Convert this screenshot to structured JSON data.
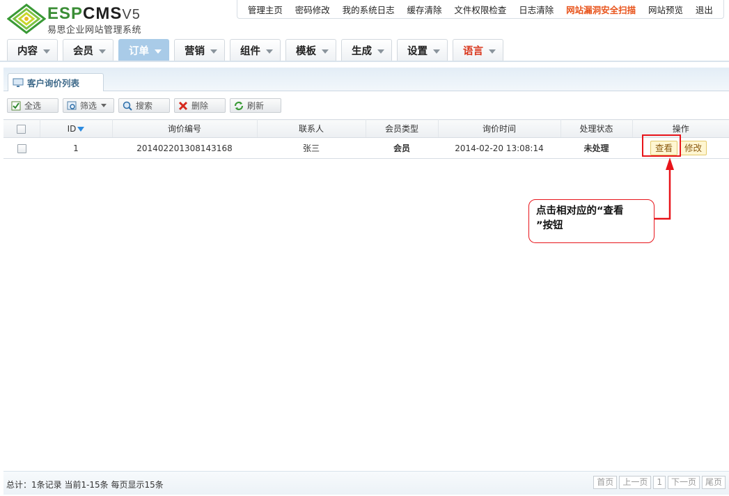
{
  "header": {
    "logo": {
      "brand_esp": "ESP",
      "brand_cms": "CMS",
      "brand_ver": "V5",
      "subtitle": "易思企业网站管理系统"
    },
    "top_links": [
      {
        "label": "管理主页"
      },
      {
        "label": "密码修改"
      },
      {
        "label": "我的系统日志"
      },
      {
        "label": "缓存清除"
      },
      {
        "label": "文件权限检查"
      },
      {
        "label": "日志清除"
      },
      {
        "label": "网站漏洞安全扫描",
        "highlight_color": "#e8541c"
      },
      {
        "label": "网站预览"
      },
      {
        "label": "退出"
      }
    ],
    "main_tabs": [
      {
        "label": "内容"
      },
      {
        "label": "会员"
      },
      {
        "label": "订单",
        "active": true
      },
      {
        "label": "营销"
      },
      {
        "label": "组件"
      },
      {
        "label": "模板"
      },
      {
        "label": "生成"
      },
      {
        "label": "设置"
      },
      {
        "label": "语言",
        "color": "#d9361c"
      }
    ]
  },
  "panel": {
    "tab_label": "客户询价列表",
    "toolbar": {
      "select_all": "全选",
      "filter": "筛选",
      "search": "搜索",
      "delete": "删除",
      "refresh": "刷新"
    }
  },
  "table": {
    "headers": {
      "id": "ID",
      "number": "询价编号",
      "contact": "联系人",
      "member_type": "会员类型",
      "time": "询价时间",
      "status": "处理状态",
      "actions": "操作"
    },
    "rows": [
      {
        "id": "1",
        "number": "201402201308143168",
        "contact": "张三",
        "member_type": "会员",
        "time": "2014-02-20 13:08:14",
        "status": "未处理",
        "view_label": "查看",
        "edit_label": "修改"
      }
    ]
  },
  "annotation": {
    "line1": "点击相对应的“查看",
    "line2": "”按钮",
    "color": "#e8141a"
  },
  "footer": {
    "info": "总计：1条记录 当前1-15条 每页显示15条",
    "pager": {
      "first": "首页",
      "prev": "上一页",
      "page": "1",
      "next": "下一页",
      "last": "尾页"
    }
  }
}
